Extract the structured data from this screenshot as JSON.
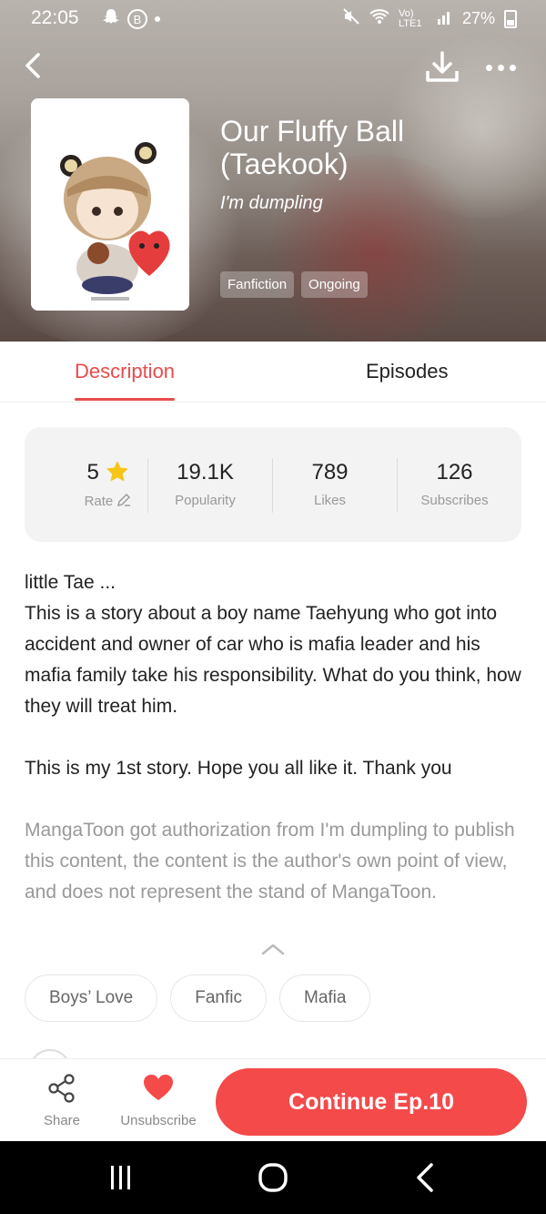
{
  "status_bar": {
    "time": "22:05",
    "b_badge": "B",
    "signal_text": "Vo) LTE1",
    "battery": "27%"
  },
  "hero": {
    "title": "Our Fluffy Ball (Taekook)",
    "author": "I'm dumpling",
    "tags": [
      "Fanfiction",
      "Ongoing"
    ]
  },
  "tabs": {
    "description": "Description",
    "episodes": "Episodes"
  },
  "stats": {
    "rate": {
      "value": "5",
      "label": "Rate"
    },
    "popularity": {
      "value": "19.1K",
      "label": "Popularity"
    },
    "likes": {
      "value": "789",
      "label": "Likes"
    },
    "subscribes": {
      "value": "126",
      "label": "Subscribes"
    }
  },
  "description": {
    "text": "little Tae  ...\nThis is a story about a boy name Taehyung who got into accident and owner of car who is mafia leader and his mafia  family take his responsibility. What do you think, how they will treat him.\n\nThis is my 1st  story. Hope you all like it. Thank you",
    "notice": "MangaToon got authorization from I'm dumpling to publish this content, the content is the author's own point of view, and does not represent the stand of MangaToon."
  },
  "genres": [
    "Boys’ Love",
    "Fanfic",
    "Mafia"
  ],
  "actions": {
    "share": "Share",
    "unsubscribe": "Unsubscribe",
    "continue": "Continue Ep.10"
  },
  "colors": {
    "accent": "#f44a4a",
    "tab_active": "#e94b4b"
  }
}
